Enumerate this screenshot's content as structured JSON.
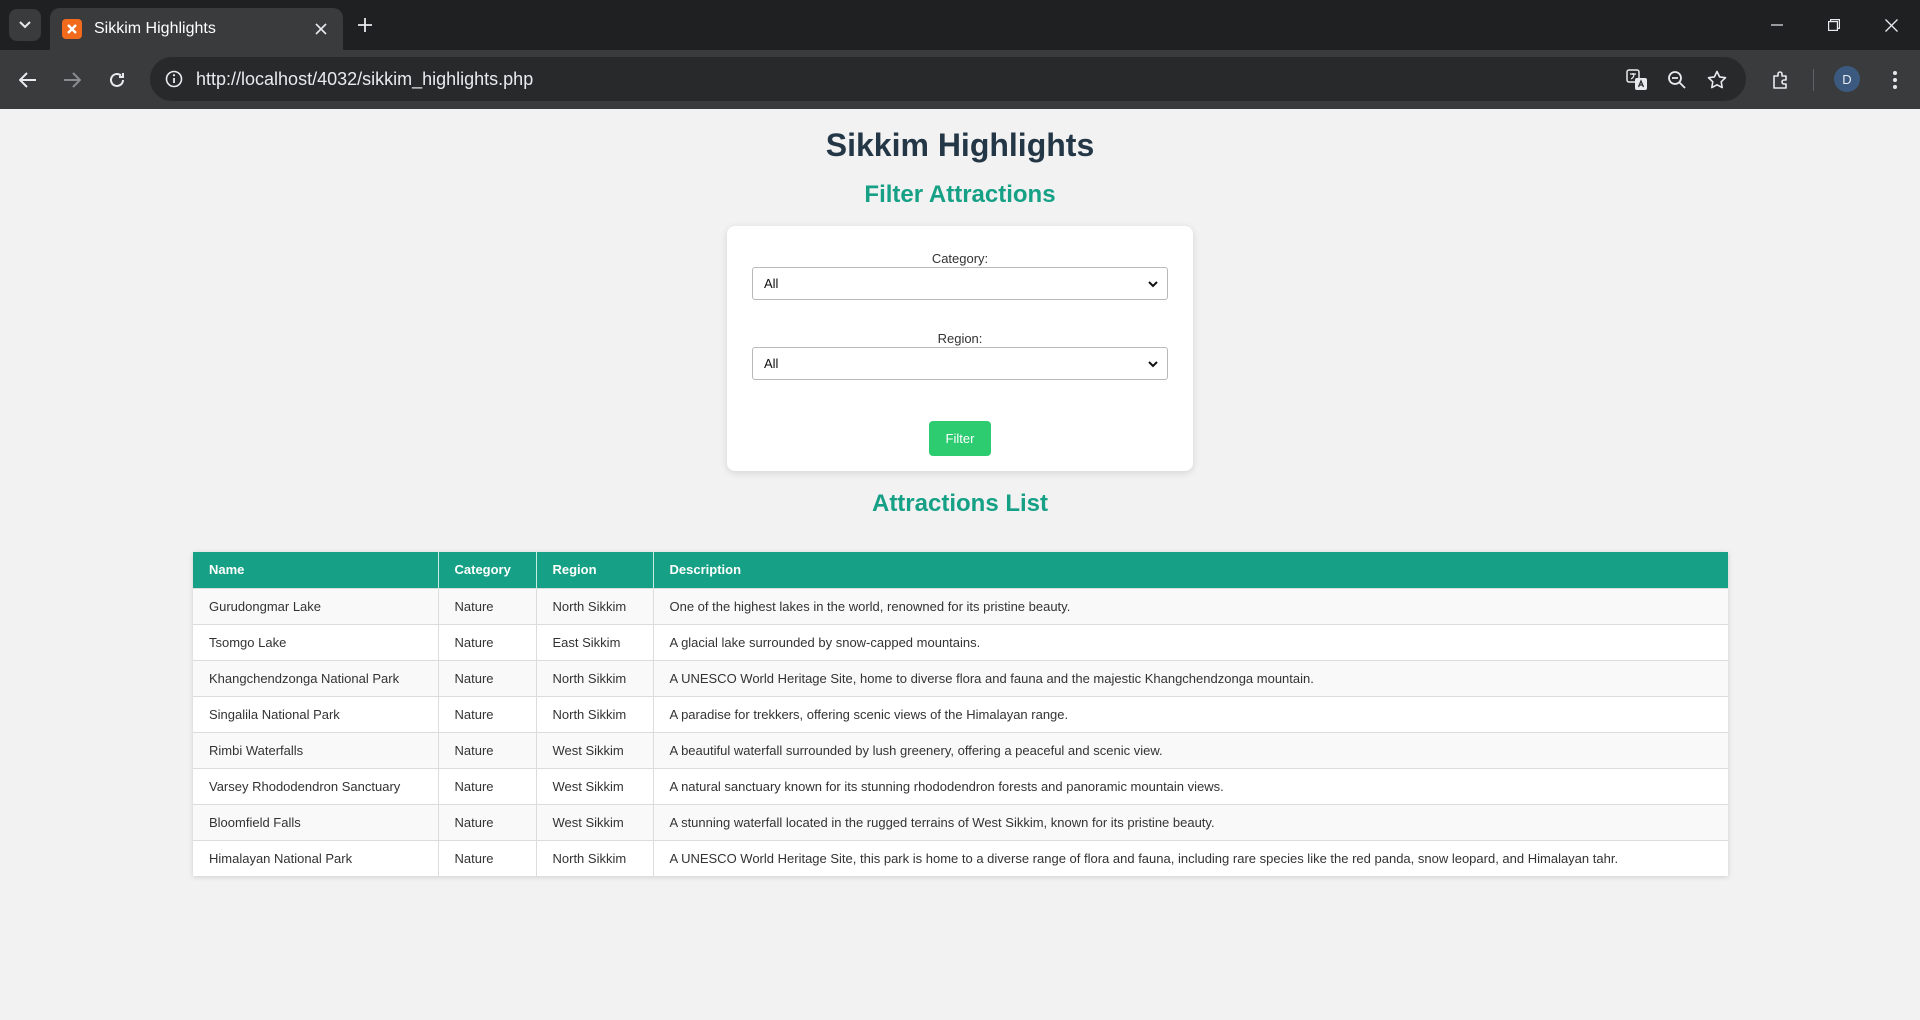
{
  "browser": {
    "tab_title": "Sikkim Highlights",
    "url": "http://localhost/4032/sikkim_highlights.php",
    "profile_initial": "D"
  },
  "page": {
    "title": "Sikkim Highlights",
    "filter_heading": "Filter Attractions",
    "category_label": "Category:",
    "category_value": "All",
    "region_label": "Region:",
    "region_value": "All",
    "filter_button": "Filter",
    "list_heading": "Attractions List"
  },
  "table": {
    "headers": [
      "Name",
      "Category",
      "Region",
      "Description"
    ],
    "rows": [
      [
        "Gurudongmar Lake",
        "Nature",
        "North Sikkim",
        "One of the highest lakes in the world, renowned for its pristine beauty."
      ],
      [
        "Tsomgo Lake",
        "Nature",
        "East Sikkim",
        "A glacial lake surrounded by snow-capped mountains."
      ],
      [
        "Khangchendzonga National Park",
        "Nature",
        "North Sikkim",
        "A UNESCO World Heritage Site, home to diverse flora and fauna and the majestic Khangchendzonga mountain."
      ],
      [
        "Singalila National Park",
        "Nature",
        "North Sikkim",
        "A paradise for trekkers, offering scenic views of the Himalayan range."
      ],
      [
        "Rimbi Waterfalls",
        "Nature",
        "West Sikkim",
        "A beautiful waterfall surrounded by lush greenery, offering a peaceful and scenic view."
      ],
      [
        "Varsey Rhododendron Sanctuary",
        "Nature",
        "West Sikkim",
        "A natural sanctuary known for its stunning rhododendron forests and panoramic mountain views."
      ],
      [
        "Bloomfield Falls",
        "Nature",
        "West Sikkim",
        "A stunning waterfall located in the rugged terrains of West Sikkim, known for its pristine beauty."
      ],
      [
        "Himalayan National Park",
        "Nature",
        "North Sikkim",
        "A UNESCO World Heritage Site, this park is home to a diverse range of flora and fauna, including rare species like the red panda, snow leopard, and Himalayan tahr."
      ]
    ]
  },
  "colors": {
    "accent": "#16a085",
    "title": "#243746",
    "button": "#2ecc71"
  }
}
